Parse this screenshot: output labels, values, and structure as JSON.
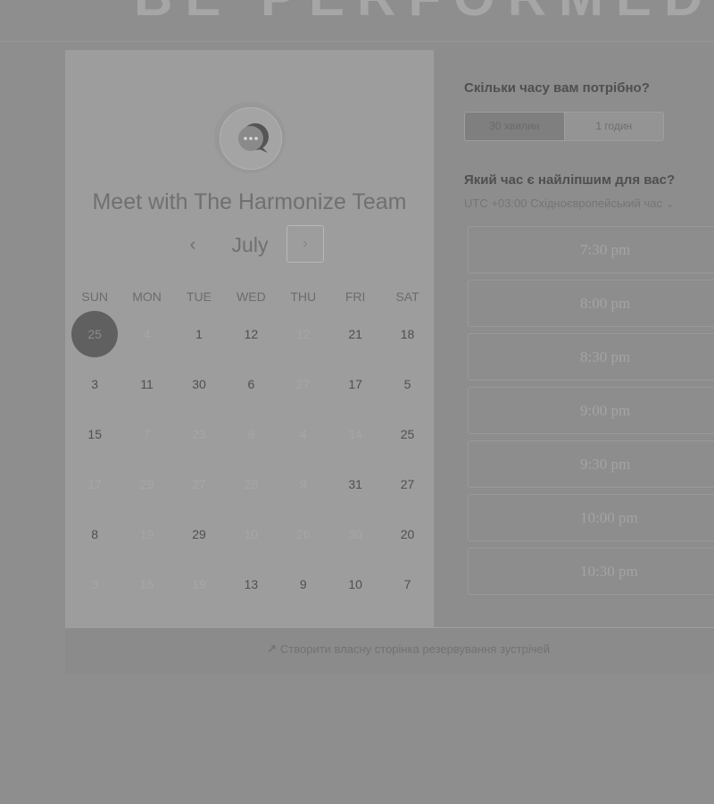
{
  "background": {
    "heading": "BE PERFORMED"
  },
  "calendar": {
    "team_title": "Meet with The Harmonize Team",
    "month": "July",
    "prev_glyph": "‹",
    "next_glyph": "›",
    "days_of_week": [
      "SUN",
      "MON",
      "TUE",
      "WED",
      "THU",
      "FRI",
      "SAT"
    ],
    "weeks": [
      [
        {
          "d": "25",
          "s": "sel"
        },
        {
          "d": "4",
          "s": "dim"
        },
        {
          "d": "1",
          "s": ""
        },
        {
          "d": "12",
          "s": ""
        },
        {
          "d": "12",
          "s": "dim"
        },
        {
          "d": "21",
          "s": ""
        },
        {
          "d": "18",
          "s": ""
        }
      ],
      [
        {
          "d": "3",
          "s": ""
        },
        {
          "d": "11",
          "s": ""
        },
        {
          "d": "30",
          "s": ""
        },
        {
          "d": "6",
          "s": ""
        },
        {
          "d": "27",
          "s": "dim"
        },
        {
          "d": "17",
          "s": ""
        },
        {
          "d": "5",
          "s": ""
        }
      ],
      [
        {
          "d": "15",
          "s": ""
        },
        {
          "d": "7",
          "s": "dim"
        },
        {
          "d": "23",
          "s": "dim"
        },
        {
          "d": "8",
          "s": "dim"
        },
        {
          "d": "4",
          "s": "dim"
        },
        {
          "d": "14",
          "s": "dim"
        },
        {
          "d": "25",
          "s": ""
        }
      ],
      [
        {
          "d": "17",
          "s": "dim"
        },
        {
          "d": "29",
          "s": "dim"
        },
        {
          "d": "27",
          "s": "dim"
        },
        {
          "d": "28",
          "s": "dim"
        },
        {
          "d": "9",
          "s": "dim"
        },
        {
          "d": "31",
          "s": ""
        },
        {
          "d": "27",
          "s": ""
        }
      ],
      [
        {
          "d": "8",
          "s": ""
        },
        {
          "d": "19",
          "s": "dim"
        },
        {
          "d": "29",
          "s": ""
        },
        {
          "d": "10",
          "s": "dim"
        },
        {
          "d": "26",
          "s": "dim"
        },
        {
          "d": "30",
          "s": "dim"
        },
        {
          "d": "20",
          "s": ""
        }
      ],
      [
        {
          "d": "3",
          "s": "dim"
        },
        {
          "d": "15",
          "s": "dim"
        },
        {
          "d": "19",
          "s": "dim"
        },
        {
          "d": "13",
          "s": ""
        },
        {
          "d": "9",
          "s": ""
        },
        {
          "d": "10",
          "s": ""
        },
        {
          "d": "7",
          "s": ""
        }
      ]
    ]
  },
  "booking": {
    "duration_question": "Скільки часу вам потрібно?",
    "durations": [
      {
        "label": "30 хвилин",
        "active": true
      },
      {
        "label": "1 годин",
        "active": false
      }
    ],
    "time_question": "Який час є найліпшим для вас?",
    "timezone": "UTC +03:00 Східноєвропейський час",
    "timezone_chevron": "⌄",
    "time_slots": [
      "7:30 pm",
      "8:00 pm",
      "8:30 pm",
      "9:00 pm",
      "9:30 pm",
      "10:00 pm",
      "10:30 pm"
    ]
  },
  "footer": {
    "icon": "sprocket-icon",
    "icon_glyph": "↗",
    "link_text": "Створити власну сторінка резервування зустрічей"
  },
  "colors": {
    "selected_day": "#606060",
    "panel": "#9d9d9d",
    "page": "#8e8e8e"
  }
}
